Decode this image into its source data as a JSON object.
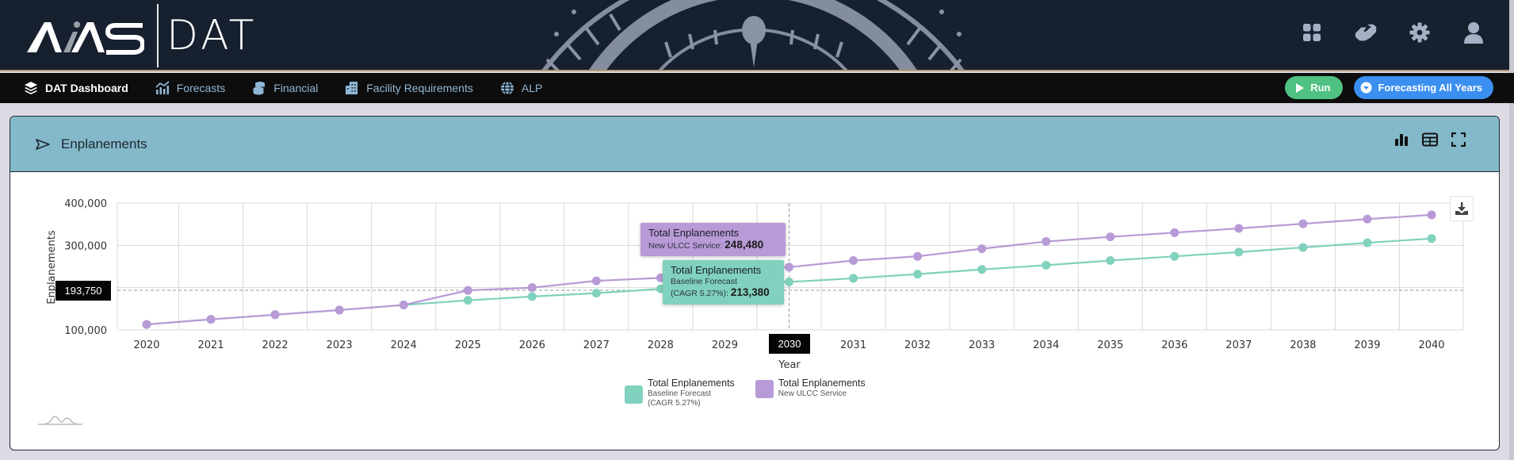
{
  "header": {
    "logo_left": "AIAS",
    "logo_right": "DAT",
    "icons": [
      "apps-grid-icon",
      "handshake-icon",
      "gear-icon",
      "user-icon"
    ]
  },
  "nav": {
    "items": [
      {
        "label": "DAT Dashboard",
        "icon": "layers-icon",
        "active": true
      },
      {
        "label": "Forecasts",
        "icon": "chart-line-icon",
        "active": false
      },
      {
        "label": "Financial",
        "icon": "coins-icon",
        "active": false
      },
      {
        "label": "Facility Requirements",
        "icon": "building-icon",
        "active": false
      },
      {
        "label": "ALP",
        "icon": "globe-icon",
        "active": false
      }
    ],
    "run_label": "Run",
    "forecast_label": "Forecasting All Years"
  },
  "card": {
    "title": "Enplanements",
    "actions": [
      "bar-chart-icon",
      "table-icon",
      "fullscreen-icon"
    ]
  },
  "colors": {
    "baseline": "#80d1bd",
    "ulcc": "#b89ad6",
    "header_bg": "#17202f",
    "card_header": "#84b9c9"
  },
  "crosshair": {
    "y_label": "193,750",
    "x_label": "2030"
  },
  "tooltips": {
    "ulcc": {
      "title": "Total Enplanements",
      "series": "New ULCC Service",
      "value": "248,480"
    },
    "baseline": {
      "title": "Total Enplanements",
      "series_line1": "Baseline Forecast",
      "series_line2": "(CAGR 5.27%)",
      "value": "213,380"
    }
  },
  "chart_data": {
    "type": "line",
    "title": "Enplanements",
    "xlabel": "Year",
    "ylabel": "Enplanements",
    "ylim": [
      100000,
      400000
    ],
    "yticks": [
      100000,
      200000,
      300000,
      400000
    ],
    "ytick_labels": [
      "100,000",
      "",
      "300,000",
      "400,000"
    ],
    "grid": true,
    "legend_position": "bottom-center",
    "x": [
      "2020",
      "2021",
      "2022",
      "2023",
      "2024",
      "2025",
      "2026",
      "2027",
      "2028",
      "2029",
      "2030",
      "2031",
      "2032",
      "2033",
      "2034",
      "2035",
      "2036",
      "2037",
      "2038",
      "2039",
      "2040"
    ],
    "series": [
      {
        "name": "Total Enplanements",
        "subtitle": [
          "Baseline Forecast",
          "(CAGR 5.27%)"
        ],
        "color": "#80d1bd",
        "values": [
          113000,
          125000,
          136000,
          147000,
          159000,
          170000,
          179000,
          187000,
          197000,
          205000,
          213380,
          222000,
          232000,
          243000,
          253000,
          264000,
          274000,
          284000,
          295000,
          306000,
          316000
        ]
      },
      {
        "name": "Total Enplanements",
        "subtitle": [
          "New ULCC Service"
        ],
        "color": "#b89ad6",
        "values": [
          113000,
          125000,
          136000,
          147000,
          159000,
          193500,
          200000,
          216000,
          223000,
          236000,
          248480,
          264000,
          274000,
          292000,
          309000,
          320000,
          330000,
          340000,
          351000,
          362000,
          372000
        ]
      }
    ]
  }
}
